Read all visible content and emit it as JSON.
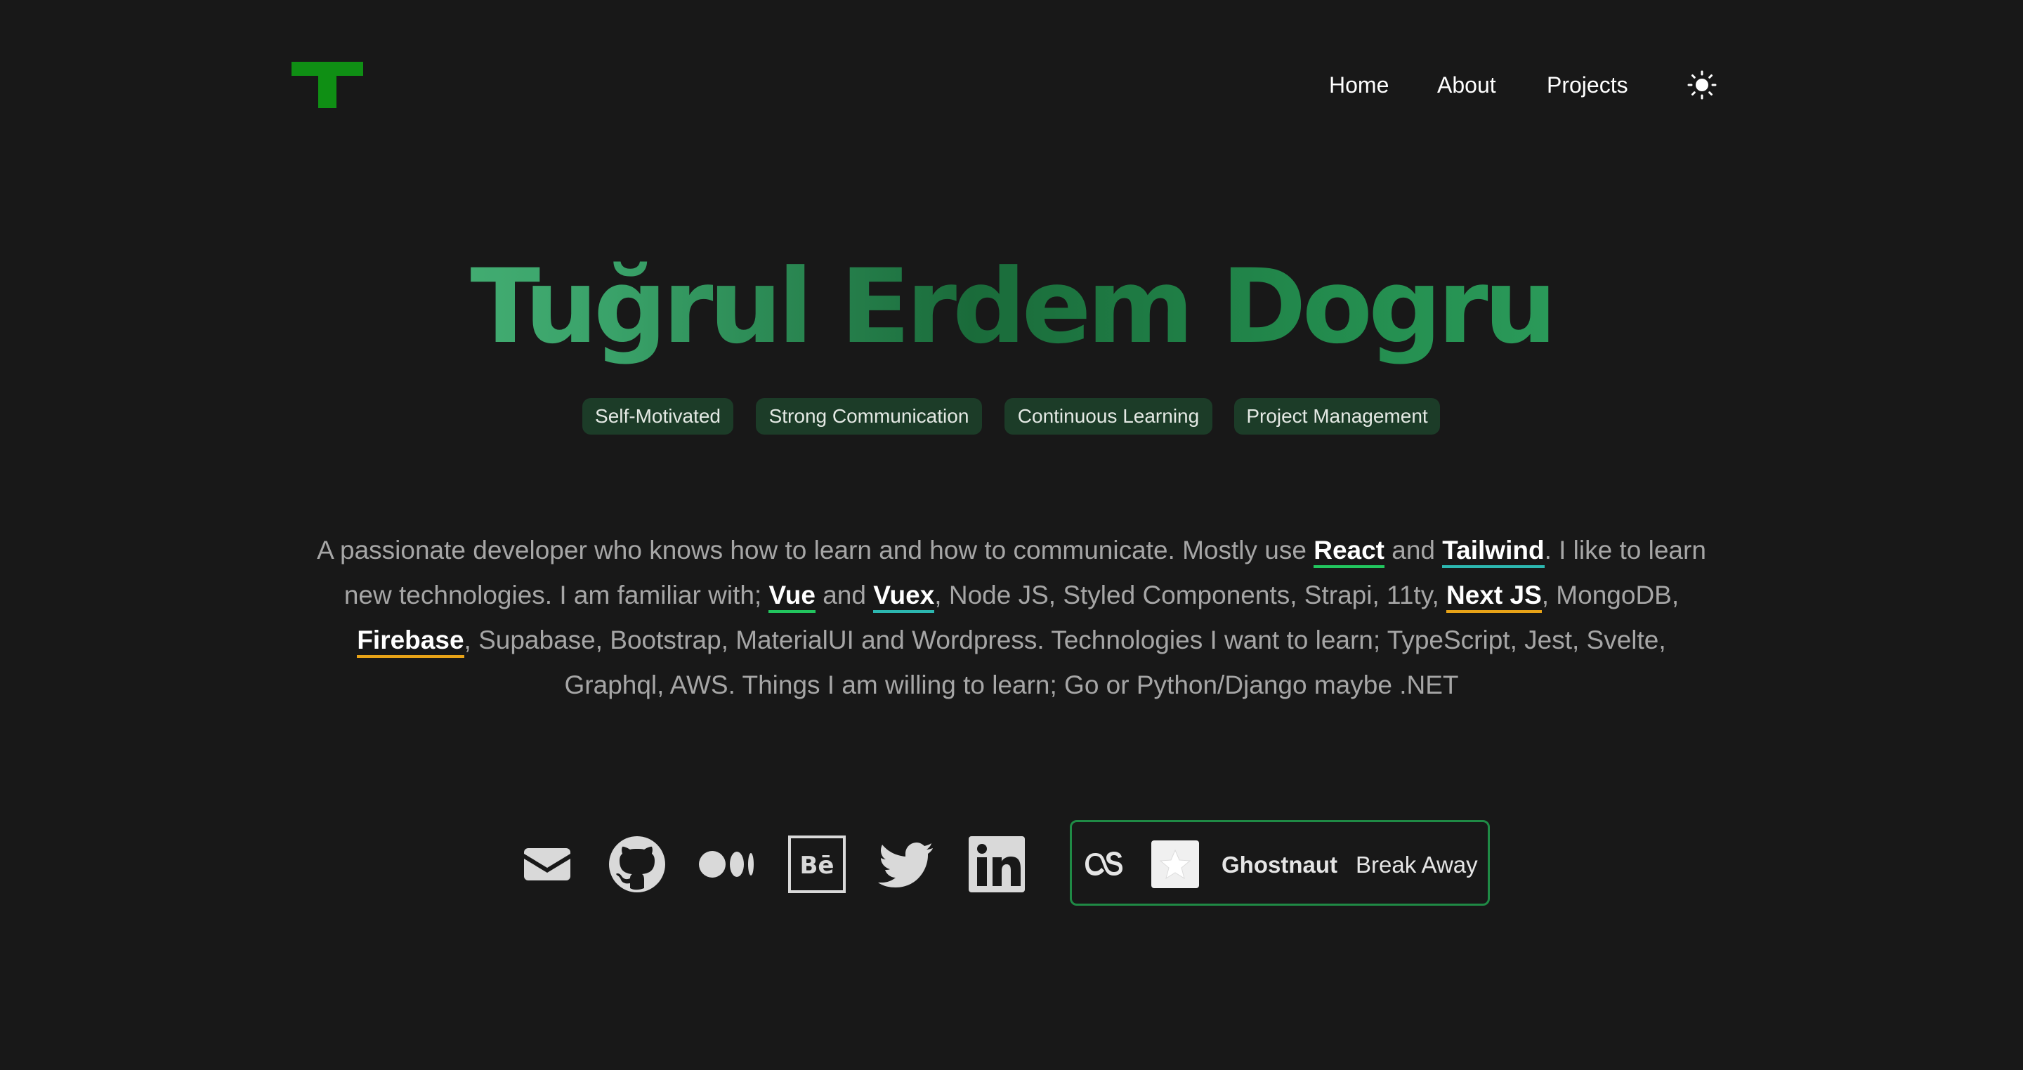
{
  "header": {
    "logo_letter": "T",
    "nav": [
      {
        "label": "Home"
      },
      {
        "label": "About"
      },
      {
        "label": "Projects"
      }
    ],
    "theme_icon": "sun-icon"
  },
  "hero": {
    "name": "Tuğrul Erdem Dogru",
    "tags": [
      "Self-Motivated",
      "Strong Communication",
      "Continuous Learning",
      "Project Management"
    ]
  },
  "bio": {
    "p1": "A passionate developer who knows how to learn and how to communicate. Mostly use ",
    "react": "React",
    "and1": " and ",
    "tailwind": "Tailwind",
    "p2": ". I like to learn new technologies. I am familiar with; ",
    "vue": "Vue",
    "and2": " and ",
    "vuex": "Vuex",
    "p3": ", Node JS, Styled Components, Strapi, 11ty, ",
    "nextjs": "Next JS",
    "p4": ", MongoDB, ",
    "firebase": "Firebase",
    "p5": ", Supabase, Bootstrap, MaterialUI and Wordpress. Technologies I want to learn; TypeScript, Jest, Svelte, Graphql, AWS. Things I am willing to learn; Go or Python/Django maybe .NET"
  },
  "social": {
    "icons": [
      "mail-icon",
      "github-icon",
      "medium-icon",
      "behance-icon",
      "twitter-icon",
      "linkedin-icon"
    ]
  },
  "now_playing": {
    "service_icon": "lastfm-icon",
    "artist": "Ghostnaut",
    "track": "Break Away"
  },
  "colors": {
    "background": "#181818",
    "logo_green": "#0f8f14",
    "tag_background": "#1c3c28",
    "accent_green": "#22c55e",
    "accent_teal": "#2cb7b0",
    "accent_amber": "#e8a317",
    "card_border": "#1f8a45"
  }
}
